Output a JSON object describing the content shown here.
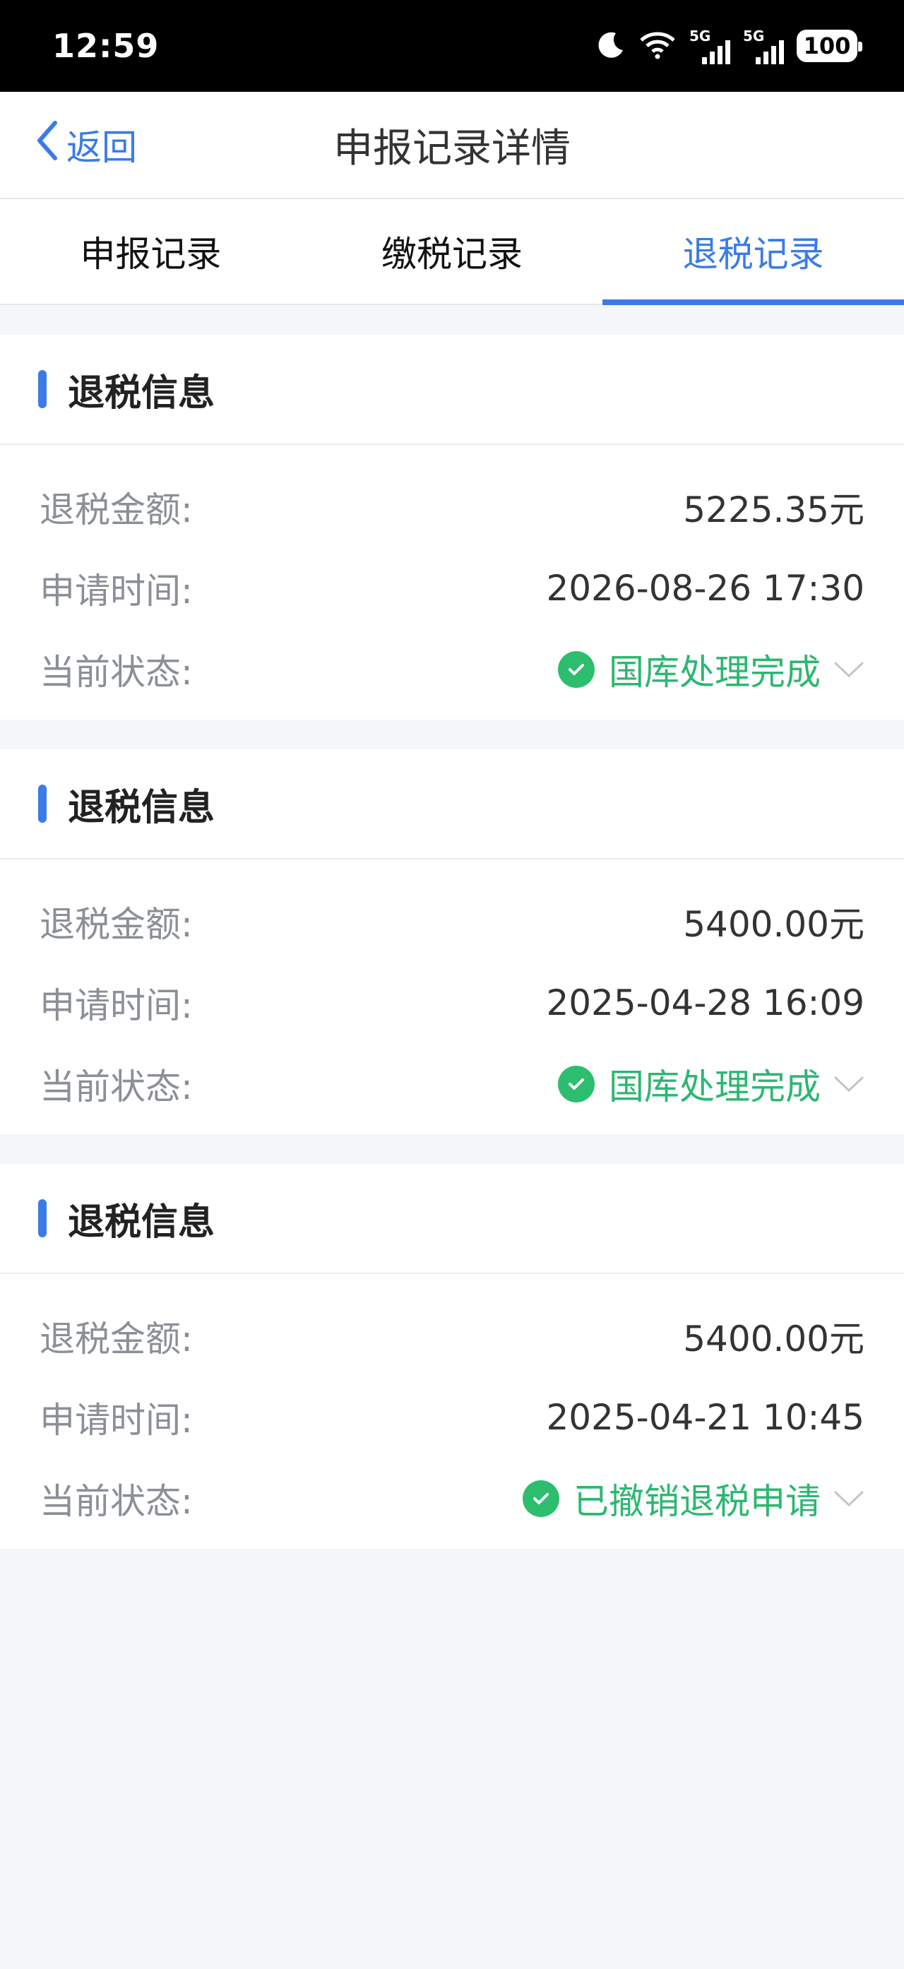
{
  "status_bar": {
    "time": "12:59",
    "network_label_1": "5G",
    "network_label_2": "5G",
    "battery": "100"
  },
  "nav": {
    "back_label": "返回",
    "title": "申报记录详情"
  },
  "tabs": [
    {
      "label": "申报记录"
    },
    {
      "label": "缴税记录"
    },
    {
      "label": "退税记录"
    }
  ],
  "labels": {
    "amount": "退税金额:",
    "time": "申请时间:",
    "status": "当前状态:"
  },
  "cards": [
    {
      "title": "退税信息",
      "amount": "5225.35元",
      "time": "2026-08-26 17:30",
      "status": "国库处理完成"
    },
    {
      "title": "退税信息",
      "amount": "5400.00元",
      "time": "2025-04-28 16:09",
      "status": "国库处理完成"
    },
    {
      "title": "退税信息",
      "amount": "5400.00元",
      "time": "2025-04-21 10:45",
      "status": "已撤销退税申请"
    }
  ],
  "colors": {
    "accent": "#3a7be8",
    "success": "#2db771",
    "background": "#f4f6f9"
  },
  "icons": [
    "moon-icon",
    "wifi-icon",
    "signal-icon",
    "battery-icon",
    "chevron-left-icon",
    "check-circle-icon",
    "chevron-down-icon"
  ]
}
